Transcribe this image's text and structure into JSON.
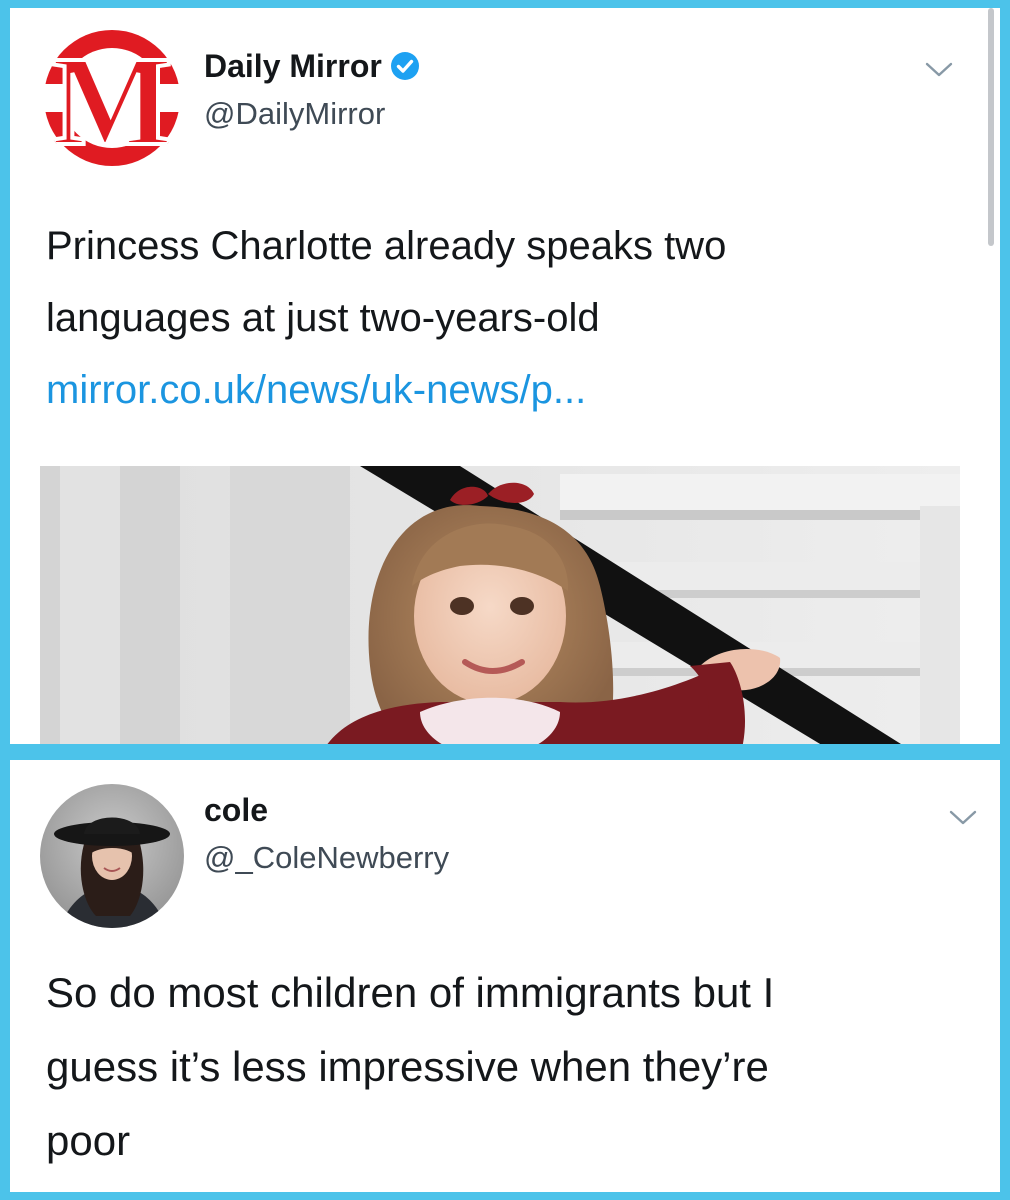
{
  "tweet": {
    "author_name": "Daily Mirror",
    "handle": "@DailyMirror",
    "logo_letter": "M",
    "text_lines": [
      "Princess Charlotte already speaks two",
      "languages at just two-years-old"
    ],
    "link": "mirror.co.uk/news/uk-news/p...",
    "icons": [
      "mirror-logo",
      "verified-badge-icon",
      "chevron-down-icon"
    ]
  },
  "reply": {
    "author_name": "cole",
    "handle": "@_ColeNewberry",
    "text_lines": [
      "So do most children of immigrants but I",
      "guess it’s less impressive when they’re",
      "poor"
    ],
    "icons": [
      "profile-photo",
      "chevron-down-icon"
    ]
  },
  "colors": {
    "frame": "#4cc3ea",
    "link": "#1b95e0",
    "mirror_red": "#e01b22",
    "verified_blue": "#1da1f2"
  }
}
